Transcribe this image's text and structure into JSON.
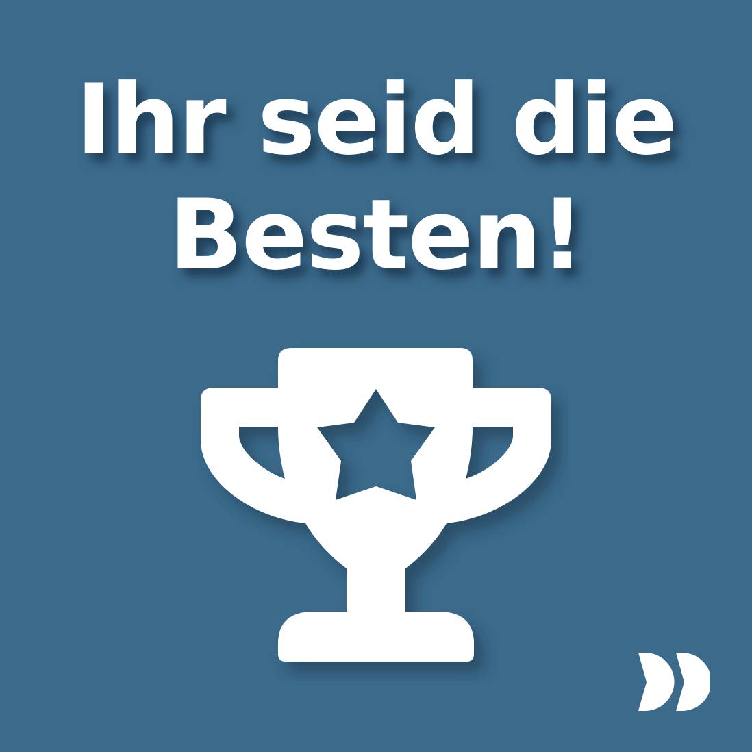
{
  "headline": {
    "line1": "Ihr seid die",
    "line2": "Besten!"
  },
  "icons": {
    "trophy": "trophy-star-icon",
    "logo": "double-chevron-logo"
  },
  "colors": {
    "background": "#3b6a8b",
    "foreground": "#ffffff",
    "shadow": "#1c3a52"
  }
}
